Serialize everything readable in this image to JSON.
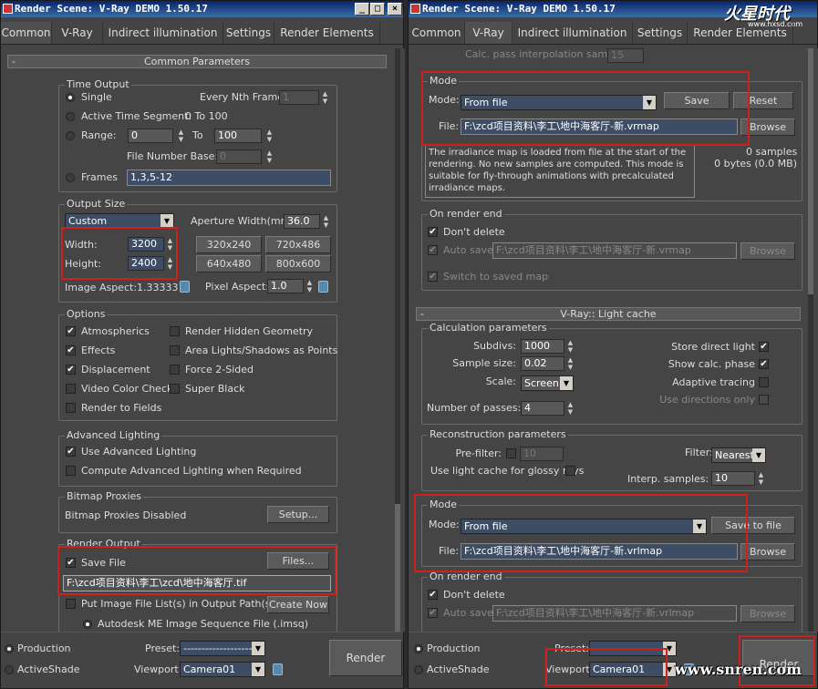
{
  "left": {
    "title": "Render Scene: V-Ray DEMO 1.50.17",
    "tabs": [
      "Common",
      "V-Ray",
      "Indirect illumination",
      "Settings",
      "Render Elements"
    ],
    "rollout_title": "Common Parameters",
    "time_output": {
      "title": "Time Output",
      "single": "Single",
      "every_nth": "Every Nth Frame:",
      "every_nth_val": "1",
      "active_segment": "Active Time Segment:",
      "active_segment_val": "0 To 100",
      "range": "Range:",
      "range_from": "0",
      "range_to_lbl": "To",
      "range_to": "100",
      "file_number_base": "File Number Base:",
      "file_number_base_val": "0",
      "frames": "Frames",
      "frames_val": "1,3,5-12"
    },
    "output_size": {
      "title": "Output Size",
      "preset": "Custom",
      "aperture": "Aperture Width(mm):",
      "aperture_val": "36.0",
      "width": "Width:",
      "width_val": "3200",
      "height": "Height:",
      "height_val": "2400",
      "sizes": [
        "320x240",
        "720x486",
        "640x480",
        "800x600"
      ],
      "image_aspect": "Image Aspect:1.33333",
      "pixel_aspect": "Pixel Aspect:",
      "pixel_aspect_val": "1.0"
    },
    "options": {
      "title": "Options",
      "atmospherics": "Atmospherics",
      "render_hidden": "Render Hidden Geometry",
      "effects": "Effects",
      "area_lights": "Area Lights/Shadows as Points",
      "displacement": "Displacement",
      "force_2sided": "Force 2-Sided",
      "video_color": "Video Color Check",
      "super_black": "Super Black",
      "render_fields": "Render to Fields"
    },
    "advanced_lighting": {
      "title": "Advanced Lighting",
      "use": "Use Advanced Lighting",
      "compute": "Compute Advanced Lighting when Required"
    },
    "bitmap_proxies": {
      "title": "Bitmap Proxies",
      "status": "Bitmap Proxies Disabled",
      "setup": "Setup..."
    },
    "render_output": {
      "title": "Render Output",
      "save_file": "Save File",
      "files": "Files...",
      "path": "F:\\zcd项目资料\\李工\\zcd\\地中海客厅.tif",
      "put_image": "Put Image File List(s) in Output Path(s)",
      "create_now": "Create Now",
      "autodesk": "Autodesk ME Image Sequence File (.imsq)"
    },
    "footer": {
      "production": "Production",
      "activeshade": "ActiveShade",
      "preset": "Preset:",
      "preset_val": "-------------------",
      "viewport": "Viewport:",
      "viewport_val": "Camera01",
      "render": "Render"
    }
  },
  "right": {
    "title": "Render Scene: V-Ray DEMO 1.50.17",
    "tabs": [
      "Common",
      "V-Ray",
      "Indirect illumination",
      "Settings",
      "Render Elements"
    ],
    "calc_pass": "Calc. pass interpolation samples",
    "calc_pass_val": "15",
    "mode1": {
      "title": "Mode",
      "mode_lbl": "Mode:",
      "mode_val": "From file",
      "save": "Save",
      "reset": "Reset",
      "file_lbl": "File:",
      "file_val": "F:\\zcd项目资料\\李工\\地中海客厅-新.vrmap",
      "browse": "Browse",
      "note": "The irradiance map is loaded from file at the start of the rendering. No new samples are computed. This mode is suitable for fly-through animations with precalculated irradiance maps.",
      "samples": "0 samples",
      "bytes": "0 bytes (0.0 MB)"
    },
    "on_render_end1": {
      "title": "On render end",
      "dont_delete": "Don't delete",
      "auto_save": "Auto save:",
      "auto_save_val": "F:\\zcd项目资料\\李工\\地中海客厅-新.vrmap",
      "browse": "Browse",
      "switch": "Switch to saved map"
    },
    "light_cache_title": "V-Ray:: Light cache",
    "calc_params": {
      "title": "Calculation parameters",
      "subdivs": "Subdivs:",
      "subdivs_val": "1000",
      "sample_size": "Sample size:",
      "sample_size_val": "0.02",
      "scale": "Scale:",
      "scale_val": "Screen",
      "passes": "Number of passes:",
      "passes_val": "4",
      "store_direct": "Store direct light",
      "show_calc": "Show calc. phase",
      "adaptive": "Adaptive tracing",
      "use_directions": "Use directions only"
    },
    "recon_params": {
      "title": "Reconstruction parameters",
      "prefilter": "Pre-filter:",
      "prefilter_val": "10",
      "filter": "Filter:",
      "filter_val": "Nearest",
      "glossy": "Use light cache for glossy rays",
      "interp": "Interp. samples:",
      "interp_val": "10"
    },
    "mode2": {
      "title": "Mode",
      "mode_lbl": "Mode:",
      "mode_val": "From file",
      "save_to_file": "Save to file",
      "file_lbl": "File:",
      "file_val": "F:\\zcd项目资料\\李工\\地中海客厅-新.vrlmap",
      "browse": "Browse"
    },
    "on_render_end2": {
      "title": "On render end",
      "dont_delete": "Don't delete",
      "auto_save": "Auto save:",
      "auto_save_val": "F:\\zcd项目资料\\李工\\地中海客厅-新.vrlmap",
      "browse": "Browse"
    },
    "footer": {
      "production": "Production",
      "activeshade": "ActiveShade",
      "preset": "Preset:",
      "preset_val": "-------------------",
      "viewport": "Viewport:",
      "viewport_val": "Camera01",
      "render": "Render"
    },
    "watermark_top": "火星时代",
    "watermark_top_url": "www.hxsd.com",
    "watermark_bottom": "www.snren.com"
  },
  "colors": {
    "accent_red": "#d0201a",
    "title_blue": "#0a246a",
    "field_blue": "#3d4d65",
    "panel_bg": "#454545"
  }
}
